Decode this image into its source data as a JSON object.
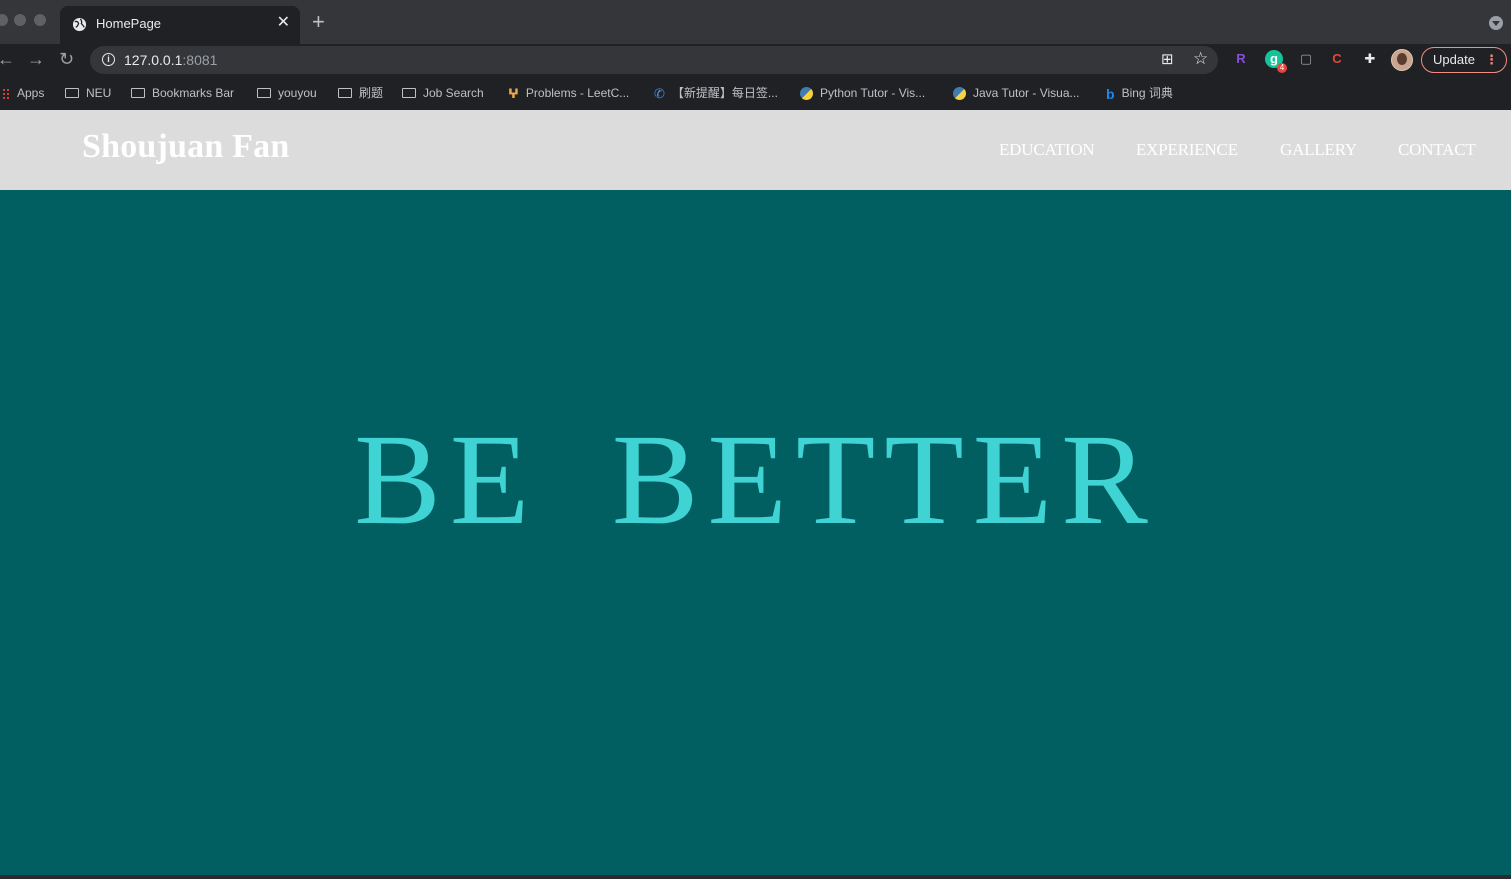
{
  "browser": {
    "tab": {
      "title": "HomePage",
      "close_glyph": "✕"
    },
    "new_tab_glyph": "+",
    "toolbar": {
      "back_glyph": "←",
      "forward_glyph": "→",
      "reload_glyph": "↻",
      "info_glyph": "i",
      "url_host": "127.0.0.1",
      "url_port": ":8081",
      "qr_glyph": "⊞",
      "star_glyph": "☆",
      "extensions": [
        {
          "icon": "r-extension-icon",
          "text": "R",
          "color": "#8a4dd9"
        },
        {
          "icon": "grammarly-extension-icon",
          "text": "g",
          "color": "#15c39a"
        },
        {
          "icon": "screenshot-extension-icon",
          "text": "▢",
          "color": "#9aa0a6"
        },
        {
          "icon": "c-extension-icon",
          "text": "C",
          "color": "#e8453c"
        },
        {
          "icon": "puzzle-extensions-icon",
          "text": "✚",
          "color": "#e8eaed"
        }
      ],
      "grammarly_badge": "4",
      "update_label": "Update",
      "menu_glyph": "⋮"
    },
    "bookmarks": [
      {
        "label": "Apps",
        "icon": "apps-grid-icon"
      },
      {
        "label": "NEU",
        "icon": "folder-icon"
      },
      {
        "label": "Bookmarks Bar",
        "icon": "folder-icon"
      },
      {
        "label": "youyou",
        "icon": "folder-icon"
      },
      {
        "label": "刷题",
        "icon": "folder-icon"
      },
      {
        "label": "Job Search",
        "icon": "folder-icon"
      },
      {
        "label": "Problems - LeetC...",
        "icon": "leetcode-icon"
      },
      {
        "label": "【新提醒】每日签...",
        "icon": "site-icon"
      },
      {
        "label": "Python Tutor - Vis...",
        "icon": "python-icon"
      },
      {
        "label": "Java Tutor - Visua...",
        "icon": "python-icon"
      },
      {
        "label": "Bing 词典",
        "icon": "bing-icon"
      }
    ]
  },
  "site": {
    "brand": "Shoujuan Fan",
    "nav": [
      "EDUCATION",
      "EXPERIENCE",
      "GALLERY",
      "CONTACT"
    ],
    "hero_text": "BE BETTER"
  },
  "colors": {
    "page_background": "#025f61",
    "navbar_background": "#dcdcdc",
    "hero_text": "#3fd3d3"
  }
}
